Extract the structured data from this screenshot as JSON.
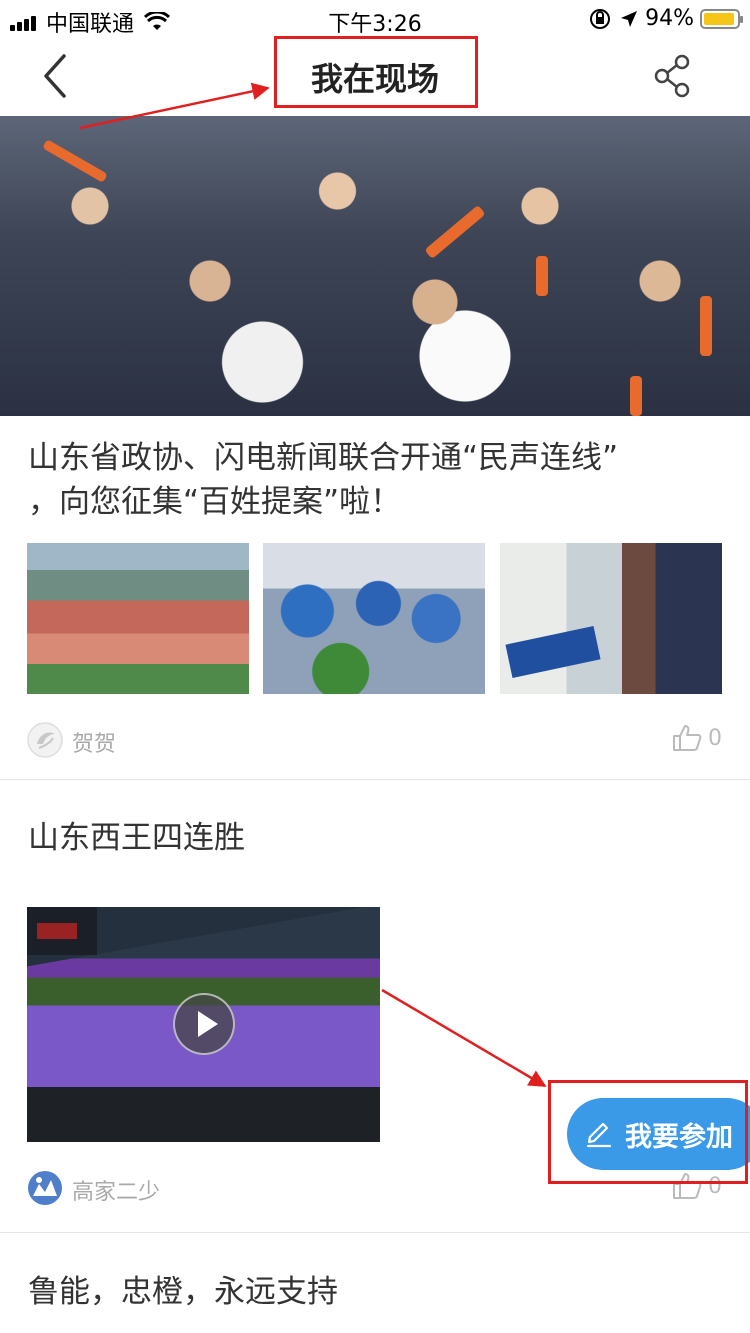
{
  "status_bar": {
    "carrier": "中国联通",
    "time": "下午3:26",
    "battery": "94%"
  },
  "header": {
    "title": "我在现场",
    "back_icon": "chevron-left-icon",
    "share_icon": "share-icon"
  },
  "posts": [
    {
      "title_line1": "山东省政协、闪电新闻联合开通“民声连线”",
      "title_line2": "，向您征集“百姓提案”啦！",
      "author": "贺贺",
      "likes": "0"
    },
    {
      "title": "山东西王四连胜",
      "author": "高家二少",
      "likes": "0"
    },
    {
      "title": "鲁能，忠橙，永远支持"
    }
  ],
  "fab": {
    "label": "我要参加",
    "icon": "pencil-icon",
    "color": "#3a9ae8"
  },
  "annotation_color": "#e02020"
}
